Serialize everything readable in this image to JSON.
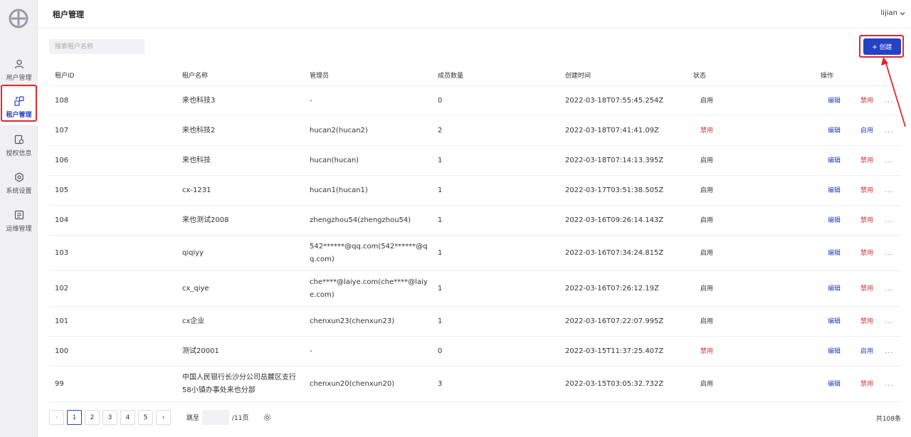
{
  "sidebar": {
    "items": [
      {
        "label": "用户管理",
        "icon": "user-icon"
      },
      {
        "label": "租户管理",
        "icon": "tenant-icon"
      },
      {
        "label": "授权信息",
        "icon": "license-icon"
      },
      {
        "label": "系统设置",
        "icon": "settings-icon"
      },
      {
        "label": "运维管理",
        "icon": "ops-icon"
      }
    ],
    "active_index": 1
  },
  "header": {
    "title": "租户管理",
    "user": "lijian"
  },
  "toolbar": {
    "search_placeholder": "搜索租户名称",
    "create_label": "创建",
    "create_icon": "+"
  },
  "table": {
    "columns": [
      "租户ID",
      "租户名称",
      "管理员",
      "成员数量",
      "创建时间",
      "状态",
      "操作"
    ],
    "rows": [
      {
        "id": "108",
        "name": "来也科技3",
        "admin": "-",
        "count": "0",
        "time": "2022-03-18T07:55:45.254Z",
        "status": "启用",
        "edit": "编辑",
        "toggle": "禁用",
        "more": "..."
      },
      {
        "id": "107",
        "name": "来也科技2",
        "admin": "hucan2(hucan2)",
        "count": "2",
        "time": "2022-03-18T07:41:41.09Z",
        "status": "禁用",
        "edit": "编辑",
        "toggle": "启用",
        "more": "..."
      },
      {
        "id": "106",
        "name": "来也科技",
        "admin": "hucan(hucan)",
        "count": "1",
        "time": "2022-03-18T07:14:13.395Z",
        "status": "启用",
        "edit": "编辑",
        "toggle": "禁用",
        "more": "..."
      },
      {
        "id": "105",
        "name": "cx-1231",
        "admin": "hucan1(hucan1)",
        "count": "1",
        "time": "2022-03-17T03:51:38.505Z",
        "status": "启用",
        "edit": "编辑",
        "toggle": "禁用",
        "more": "..."
      },
      {
        "id": "104",
        "name": "来也测试2008",
        "admin": "zhengzhou54(zhengzhou54)",
        "count": "1",
        "time": "2022-03-16T09:26:14.143Z",
        "status": "启用",
        "edit": "编辑",
        "toggle": "禁用",
        "more": "..."
      },
      {
        "id": "103",
        "name": "qiqiyy",
        "admin": "542******@qq.com(542******@qq.com)",
        "count": "1",
        "time": "2022-03-16T07:34:24.815Z",
        "status": "启用",
        "edit": "编辑",
        "toggle": "禁用",
        "more": "..."
      },
      {
        "id": "102",
        "name": "cx_qiye",
        "admin": "che****@laiye.com(che****@laiye.com)",
        "count": "1",
        "time": "2022-03-16T07:26:12.19Z",
        "status": "启用",
        "edit": "编辑",
        "toggle": "禁用",
        "more": "..."
      },
      {
        "id": "101",
        "name": "cx企业",
        "admin": "chenxun23(chenxun23)",
        "count": "1",
        "time": "2022-03-16T07:22:07.995Z",
        "status": "启用",
        "edit": "编辑",
        "toggle": "禁用",
        "more": "..."
      },
      {
        "id": "100",
        "name": "测试20001",
        "admin": "-",
        "count": "0",
        "time": "2022-03-15T11:37:25.407Z",
        "status": "禁用",
        "edit": "编辑",
        "toggle": "启用",
        "more": "..."
      },
      {
        "id": "99",
        "name": "中国人民银行长沙分公司岳麓区支行58小镇办事处来也分部",
        "admin": "chenxun20(chenxun20)",
        "count": "3",
        "time": "2022-03-15T03:05:32.732Z",
        "status": "启用",
        "edit": "编辑",
        "toggle": "禁用",
        "more": "..."
      }
    ]
  },
  "pagination": {
    "prev": "‹",
    "next": "›",
    "pages": [
      "1",
      "2",
      "3",
      "4",
      "5"
    ],
    "current": "1",
    "jump_label": "跳至",
    "page_suffix": "/11页",
    "total_label": "共108条"
  },
  "colors": {
    "accent": "#2541c4",
    "danger": "#d9363e",
    "annotation": "#e5262b"
  }
}
